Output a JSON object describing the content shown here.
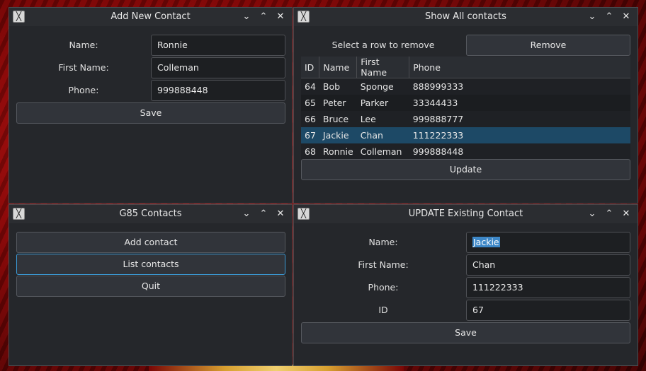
{
  "add_window": {
    "title": "Add New Contact",
    "name_label": "Name:",
    "name_value": "Ronnie",
    "first_name_label": "First Name:",
    "first_name_value": "Colleman",
    "phone_label": "Phone:",
    "phone_value": "999888448",
    "save_label": "Save"
  },
  "show_window": {
    "title": "Show All contacts",
    "hint": "Select a row to remove",
    "remove_label": "Remove",
    "columns": [
      "ID",
      "Name",
      "First Name",
      "Phone"
    ],
    "rows": [
      [
        "64",
        "Bob",
        "Sponge",
        "888999333"
      ],
      [
        "65",
        "Peter",
        "Parker",
        "33344433"
      ],
      [
        "66",
        "Bruce",
        "Lee",
        "999888777"
      ],
      [
        "67",
        "Jackie",
        "Chan",
        "111222333"
      ],
      [
        "68",
        "Ronnie",
        "Colleman",
        "999888448"
      ]
    ],
    "selected_row_index": 3,
    "update_label": "Update"
  },
  "main_window": {
    "title": "G85 Contacts",
    "add_label": "Add contact",
    "list_label": "List contacts",
    "quit_label": "Quit"
  },
  "update_window": {
    "title": "UPDATE Existing Contact",
    "name_label": "Name:",
    "name_value": "Jackie",
    "first_name_label": "First Name:",
    "first_name_value": "Chan",
    "phone_label": "Phone:",
    "phone_value": "111222333",
    "id_label": "ID",
    "id_value": "67",
    "save_label": "Save"
  },
  "titlebar_icons": {
    "app": "x-window-icon",
    "minimize": "chevron-down-icon",
    "maximize": "chevron-up-icon",
    "close": "close-icon"
  },
  "colors": {
    "accent": "#3b9ad6",
    "selection": "#1d4966",
    "window_bg": "#25272b",
    "wallpaper": "#8a0808"
  }
}
